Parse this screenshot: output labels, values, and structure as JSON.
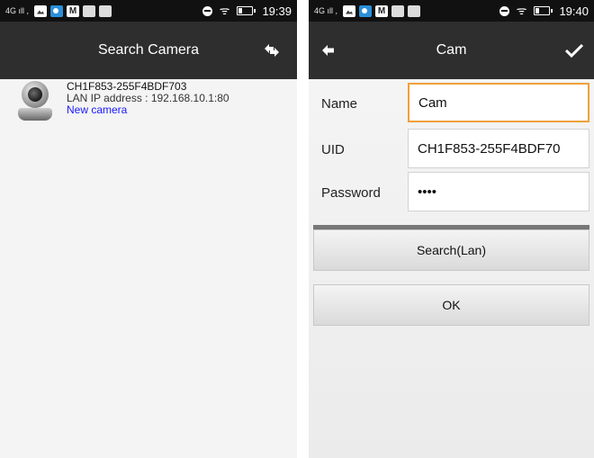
{
  "left_screen": {
    "status_bar": {
      "signal": "4G",
      "time": "19:39"
    },
    "title": "Search Camera",
    "action_icon": "swap-arrows-icon",
    "cameras": [
      {
        "uid": "CH1F853-255F4BDF703",
        "ip": "LAN IP address : 192.168.10.1:80",
        "status": "New camera"
      }
    ]
  },
  "right_screen": {
    "status_bar": {
      "signal": "4G",
      "time": "19:40"
    },
    "title": "Cam",
    "fields": {
      "name": {
        "label": "Name",
        "value": "Cam"
      },
      "uid": {
        "label": "UID",
        "value": "CH1F853-255F4BDF70"
      },
      "password": {
        "label": "Password",
        "value": "••••"
      }
    },
    "buttons": {
      "search": "Search(Lan)",
      "ok": "OK"
    }
  },
  "colors": {
    "title_bar": "#2e2e2e",
    "status_bar": "#111111",
    "focus_border": "#f0a03c",
    "new_camera_text": "#1a1aff"
  }
}
